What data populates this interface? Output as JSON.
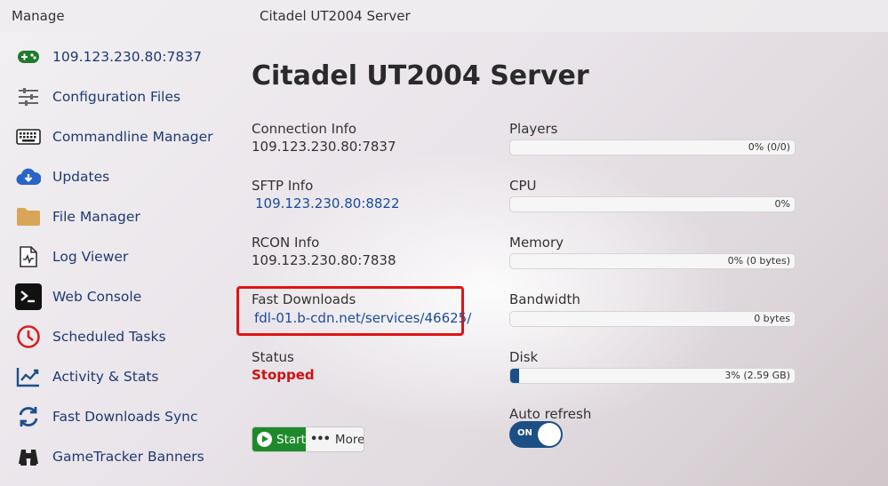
{
  "topbar": {
    "manage": "Manage",
    "server_name": "Citadel UT2004 Server"
  },
  "sidebar": {
    "items": [
      {
        "label": "109.123.230.80:7837",
        "icon": "gamepad-icon"
      },
      {
        "label": "Configuration Files",
        "icon": "sliders-icon"
      },
      {
        "label": "Commandline Manager",
        "icon": "keyboard-icon"
      },
      {
        "label": "Updates",
        "icon": "cloud-download-icon"
      },
      {
        "label": "File Manager",
        "icon": "folder-icon"
      },
      {
        "label": "Log Viewer",
        "icon": "file-pulse-icon"
      },
      {
        "label": "Web Console",
        "icon": "terminal-icon"
      },
      {
        "label": "Scheduled Tasks",
        "icon": "clock-icon"
      },
      {
        "label": "Activity & Stats",
        "icon": "chart-line-icon"
      },
      {
        "label": "Fast Downloads Sync",
        "icon": "sync-icon"
      },
      {
        "label": "GameTracker Banners",
        "icon": "binoculars-icon"
      }
    ]
  },
  "main": {
    "title": "Citadel UT2004 Server",
    "connection": {
      "label": "Connection Info",
      "value": "109.123.230.80:7837"
    },
    "sftp": {
      "label": "SFTP Info",
      "value": "109.123.230.80:8822"
    },
    "rcon": {
      "label": "RCON Info",
      "value": "109.123.230.80:7838"
    },
    "fastdl": {
      "label": "Fast Downloads",
      "value": "fdl-01.b-cdn.net/services/46625/"
    },
    "status": {
      "label": "Status",
      "value": "Stopped"
    },
    "actions": {
      "start": "Start",
      "more": "More"
    }
  },
  "stats": {
    "players": {
      "label": "Players",
      "text": "0% (0/0)",
      "fraction": 0
    },
    "cpu": {
      "label": "CPU",
      "text": "0%",
      "fraction": 0
    },
    "memory": {
      "label": "Memory",
      "text": "0% (0 bytes)",
      "fraction": 0
    },
    "bandwidth": {
      "label": "Bandwidth",
      "text": "0 bytes",
      "fraction": 0
    },
    "disk": {
      "label": "Disk",
      "text": "3% (2.59 GB)",
      "fraction": 0.03
    },
    "auto_refresh": {
      "label": "Auto refresh",
      "state": "ON"
    }
  },
  "colors": {
    "accent": "#1c4f86",
    "start": "#1f8a2b",
    "stopped": "#cc1111",
    "link": "#1a4c9b",
    "highlight": "#e01414"
  }
}
